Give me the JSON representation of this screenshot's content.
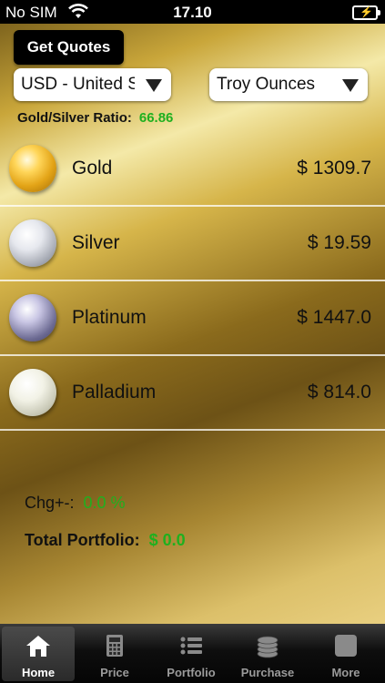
{
  "status": {
    "carrier": "No SIM",
    "time": "17.10"
  },
  "toolbar": {
    "quotes_label": "Get Quotes"
  },
  "selects": {
    "currency": "USD - United States",
    "unit": "Troy Ounces"
  },
  "ratio": {
    "label": "Gold/Silver Ratio:",
    "value": "66.86"
  },
  "metals": [
    {
      "name": "Gold",
      "price": "$ 1309.7",
      "icon": "gold-ball-icon"
    },
    {
      "name": "Silver",
      "price": "$ 19.59",
      "icon": "silver-ball-icon"
    },
    {
      "name": "Platinum",
      "price": "$ 1447.0",
      "icon": "platinum-ball-icon"
    },
    {
      "name": "Palladium",
      "price": "$ 814.0",
      "icon": "palladium-ball-icon"
    }
  ],
  "summary": {
    "chg_label": "Chg+-:",
    "chg_value": "0.0 %",
    "total_label": "Total Portfolio:",
    "total_value": "$ 0.0"
  },
  "tabs": [
    {
      "label": "Home",
      "icon": "home-icon",
      "active": true
    },
    {
      "label": "Price",
      "icon": "calculator-icon",
      "active": false
    },
    {
      "label": "Portfolio",
      "icon": "list-icon",
      "active": false
    },
    {
      "label": "Purchase",
      "icon": "coins-icon",
      "active": false
    },
    {
      "label": "More",
      "icon": "more-icon",
      "active": false
    }
  ],
  "colors": {
    "positive": "#1fb01f",
    "tab_active": "#ffffff",
    "tab_inactive": "#9a9a9a"
  }
}
